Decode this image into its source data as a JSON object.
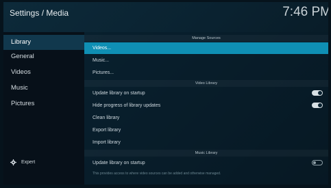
{
  "header": {
    "title": "Settings / Media",
    "clock": "7:46 PM"
  },
  "sidebar": {
    "items": [
      {
        "label": "Library",
        "active": true
      },
      {
        "label": "General"
      },
      {
        "label": "Videos"
      },
      {
        "label": "Music"
      },
      {
        "label": "Pictures"
      }
    ],
    "expert_label": "Expert"
  },
  "content": {
    "manage_sources": {
      "title": "Manage Sources",
      "items": [
        "Videos...",
        "Music...",
        "Pictures..."
      ]
    },
    "video_library": {
      "title": "Video Library",
      "items": [
        {
          "label": "Update library on startup",
          "toggle": "on"
        },
        {
          "label": "Hide progress of library updates",
          "toggle": "on"
        },
        {
          "label": "Clean library"
        },
        {
          "label": "Export library"
        },
        {
          "label": "Import library"
        }
      ]
    },
    "music_library": {
      "title": "Music Library",
      "items": [
        {
          "label": "Update library on startup",
          "toggle": "off"
        }
      ]
    },
    "hint": "This provides access to where video sources can be added and otherwise managed."
  },
  "colors": {
    "accent": "#0f8fb4",
    "sidebar_active": "#11384d",
    "background": "#0a2230"
  }
}
